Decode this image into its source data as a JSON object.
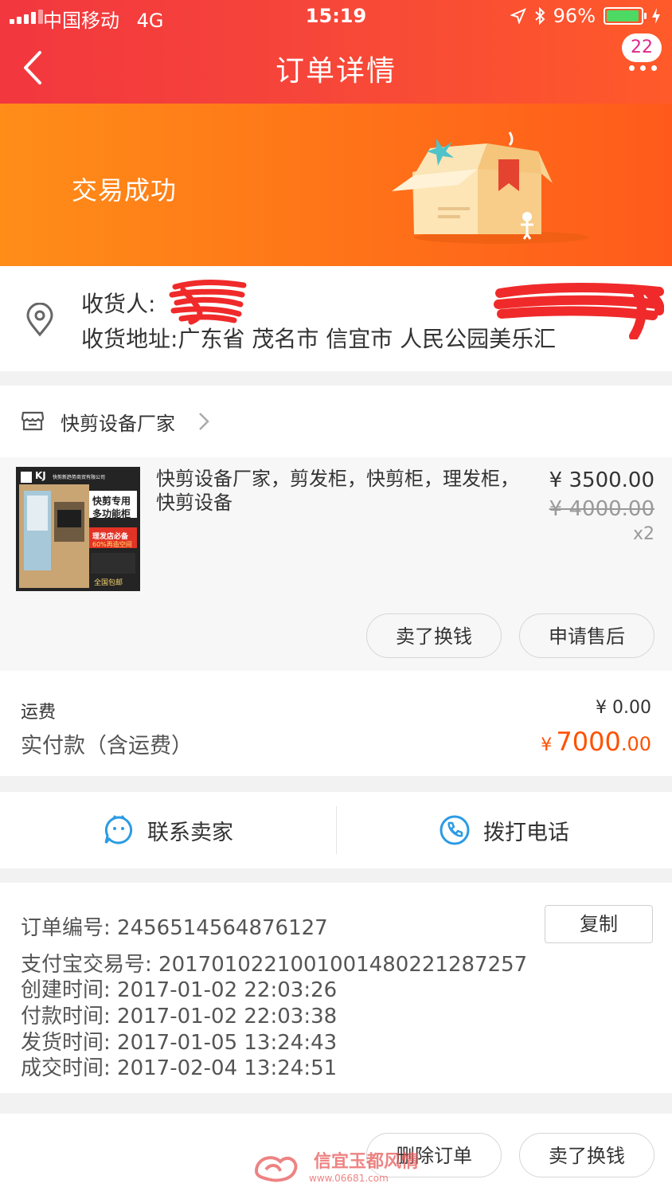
{
  "status_bar": {
    "carrier": "中国移动",
    "network": "4G",
    "time": "15:19",
    "battery": "96%",
    "battery_level": 0.96
  },
  "header": {
    "title": "订单详情",
    "message_count": "22"
  },
  "banner": {
    "status_text": "交易成功"
  },
  "address": {
    "receiver_label": "收货人:",
    "address_label": "收货地址:",
    "address_value": "广东省 茂名市 信宜市 人民公园美乐汇"
  },
  "shop": {
    "name": "快剪设备厂家"
  },
  "product": {
    "title": "快剪设备厂家，剪发柜，快剪柜，理发柜，快剪设备",
    "price": "¥ 3500.00",
    "original_price": "¥ 4000.00",
    "quantity": "x2",
    "thumbnail": {
      "brand": "KJ",
      "company": "快剪新趋势商贸有限公司",
      "headline_1": "快剪专用",
      "headline_2": "多功能柜",
      "tag_1": "理发店必备",
      "tag_2": "60%再造空间",
      "note": "全国包邮"
    }
  },
  "item_actions": {
    "sell_label": "卖了换钱",
    "after_sale_label": "申请售后"
  },
  "fees": {
    "shipping_label": "运费",
    "shipping_value": "¥ 0.00",
    "paid_label": "实付款（含运费）",
    "paid_currency": "¥",
    "paid_integer": "7000",
    "paid_decimal": ".00"
  },
  "contact": {
    "seller_label": "联系卖家",
    "call_label": "拨打电话"
  },
  "order_info": {
    "order_no": "订单编号:  2456514564876127",
    "alipay_no": "支付宝交易号:  2017010221001001480221287257",
    "created": "创建时间:  2017-01-02 22:03:26",
    "paid": "付款时间:  2017-01-02 22:03:38",
    "shipped": "发货时间:  2017-01-05 13:24:43",
    "closed": "成交时间:  2017-02-04 13:24:51",
    "copy_label": "复制"
  },
  "bottom_actions": {
    "delete_label": "删除订单",
    "sell_label": "卖了换钱"
  },
  "watermark": {
    "text": "信宜玉都风情",
    "url": "www.06681.com"
  },
  "colors": {
    "header_red": "#f2373e",
    "banner_orange": "#ff7418",
    "price_orange": "#ff5000"
  }
}
